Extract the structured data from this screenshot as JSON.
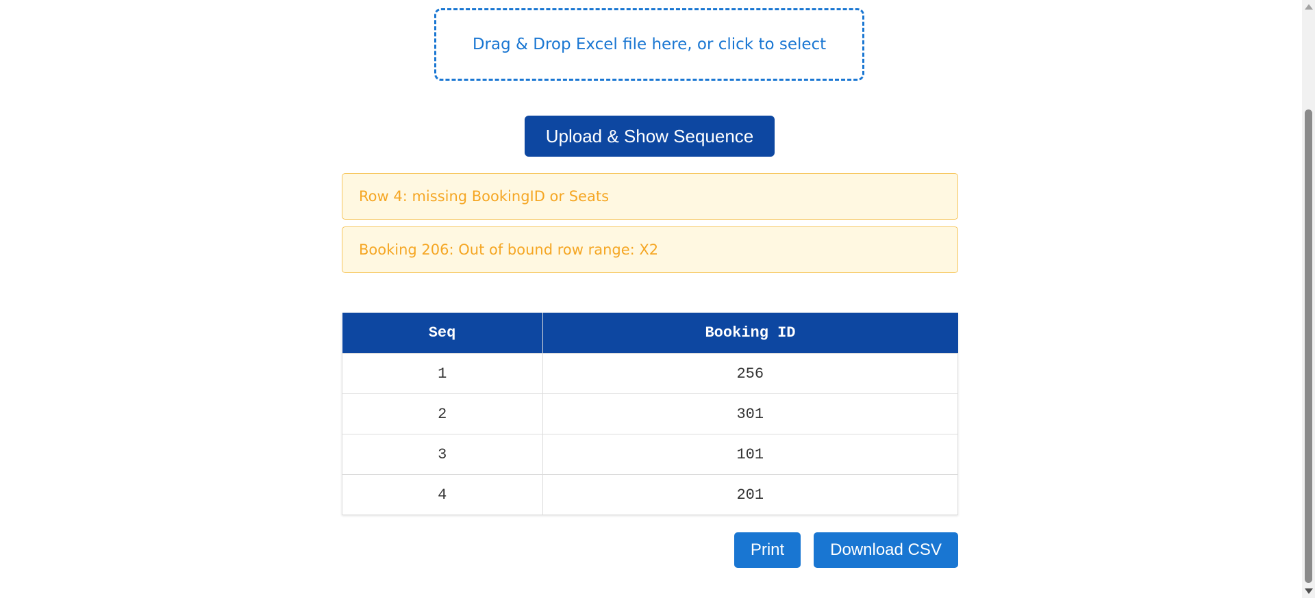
{
  "dropzone": {
    "text": "Drag & Drop Excel file here, or click to select"
  },
  "upload_button": {
    "label": "Upload & Show Sequence"
  },
  "alerts": [
    "Row 4: missing BookingID or Seats",
    "Booking 206: Out of bound row range: X2"
  ],
  "table": {
    "headers": [
      "Seq",
      "Booking ID"
    ],
    "rows": [
      [
        "1",
        "256"
      ],
      [
        "2",
        "301"
      ],
      [
        "3",
        "101"
      ],
      [
        "4",
        "201"
      ]
    ]
  },
  "actions": {
    "print_label": "Print",
    "csv_label": "Download CSV"
  },
  "colors": {
    "primary_dark": "#0d47a1",
    "primary": "#1976d2",
    "warning_bg": "#fff8e1",
    "warning_text": "#f5a623"
  }
}
